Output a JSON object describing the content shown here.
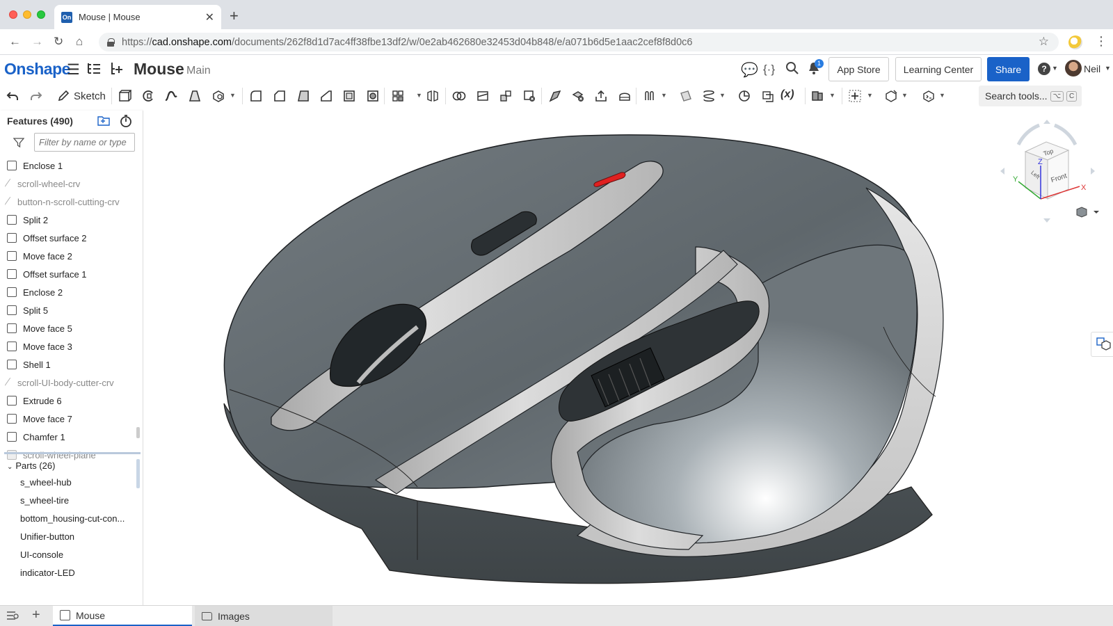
{
  "browser": {
    "tab_title": "Mouse | Mouse",
    "favicon_text": "On",
    "url_host": "cad.onshape.com",
    "url_prefix": "https://",
    "url_path": "/documents/262f8d1d7ac4ff38fbe13df2/w/0e2ab462680e32453d04b848/e/a071b6d5e1aac2cef8f8d0c6"
  },
  "header": {
    "logo": "Onshape",
    "document_title": "Mouse",
    "workspace": "Main",
    "notification_count": "1",
    "app_store": "App Store",
    "learning_center": "Learning Center",
    "share": "Share",
    "user_name": "Neil"
  },
  "toolbar": {
    "sketch_label": "Sketch",
    "search_placeholder": "Search tools...",
    "search_shortcut_1": "⌥",
    "search_shortcut_2": "C"
  },
  "feature_panel": {
    "title": "Features (490)",
    "filter_placeholder": "Filter by name or type",
    "features": [
      {
        "label": "Enclose 1",
        "kind": "feature"
      },
      {
        "label": "scroll-wheel-crv",
        "kind": "sketch"
      },
      {
        "label": "button-n-scroll-cutting-crv",
        "kind": "sketch"
      },
      {
        "label": "Split 2",
        "kind": "feature"
      },
      {
        "label": "Offset surface 2",
        "kind": "feature"
      },
      {
        "label": "Move face 2",
        "kind": "feature"
      },
      {
        "label": "Offset surface 1",
        "kind": "feature"
      },
      {
        "label": "Enclose 2",
        "kind": "feature"
      },
      {
        "label": "Split 5",
        "kind": "feature"
      },
      {
        "label": "Move face 5",
        "kind": "feature"
      },
      {
        "label": "Move face 3",
        "kind": "feature"
      },
      {
        "label": "Shell 1",
        "kind": "feature"
      },
      {
        "label": "scroll-UI-body-cutter-crv",
        "kind": "sketch"
      },
      {
        "label": "Extrude 6",
        "kind": "feature"
      },
      {
        "label": "Move face 7",
        "kind": "feature"
      },
      {
        "label": "Chamfer 1",
        "kind": "feature"
      },
      {
        "label": "scroll-wheel-plane",
        "kind": "plane"
      }
    ],
    "parts_title": "Parts (26)",
    "parts": [
      "s_wheel-hub",
      "s_wheel-tire",
      "bottom_housing-cut-con...",
      "Unifier-button",
      "UI-console",
      "indicator-LED"
    ]
  },
  "viewcube": {
    "top": "Top",
    "front": "Front",
    "left": "Left",
    "axis_x": "X",
    "axis_y": "Y",
    "axis_z": "Z"
  },
  "bottom_tabs": {
    "active_tab": "Mouse",
    "folder_tab": "Images"
  },
  "colors": {
    "accent": "#1a62c8",
    "body_grey": "#6c7479",
    "console_silver": "#c9c9c9",
    "led_red": "#e02020"
  }
}
